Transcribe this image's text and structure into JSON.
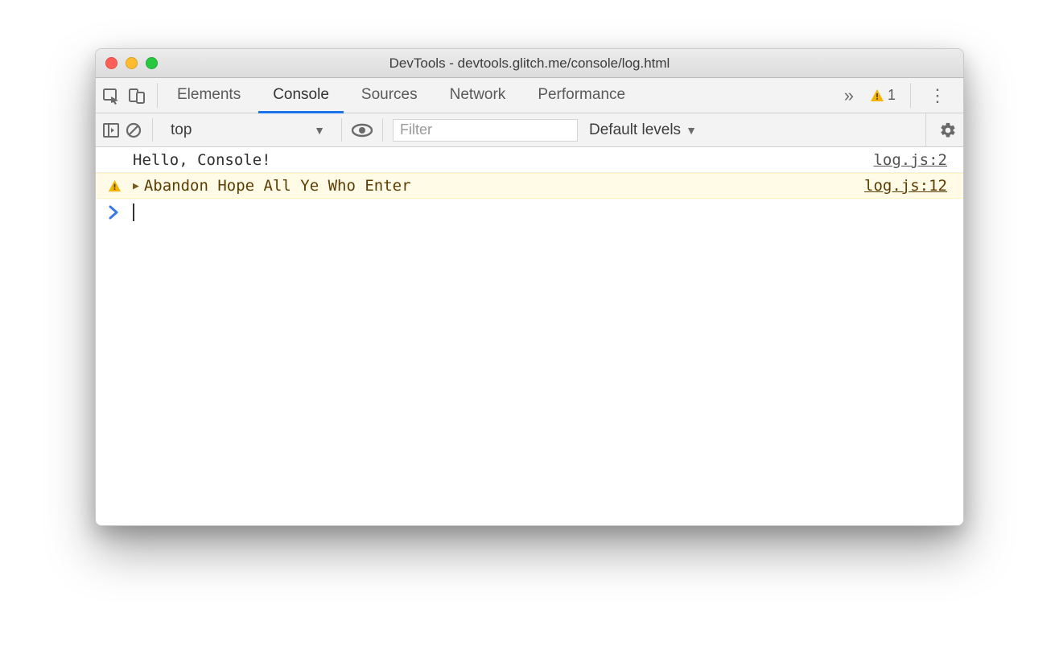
{
  "window": {
    "title": "DevTools - devtools.glitch.me/console/log.html"
  },
  "tabs": {
    "items": [
      "Elements",
      "Console",
      "Sources",
      "Network",
      "Performance"
    ],
    "active_index": 1,
    "overflow_glyph": "»",
    "warning_count": "1"
  },
  "console_toolbar": {
    "context": "top",
    "filter_placeholder": "Filter",
    "levels_label": "Default levels"
  },
  "console": {
    "rows": [
      {
        "type": "log",
        "message": "Hello, Console!",
        "source": "log.js:2"
      },
      {
        "type": "warn",
        "message": "Abandon Hope All Ye Who Enter",
        "source": "log.js:12"
      }
    ],
    "prompt_glyph": "›"
  }
}
